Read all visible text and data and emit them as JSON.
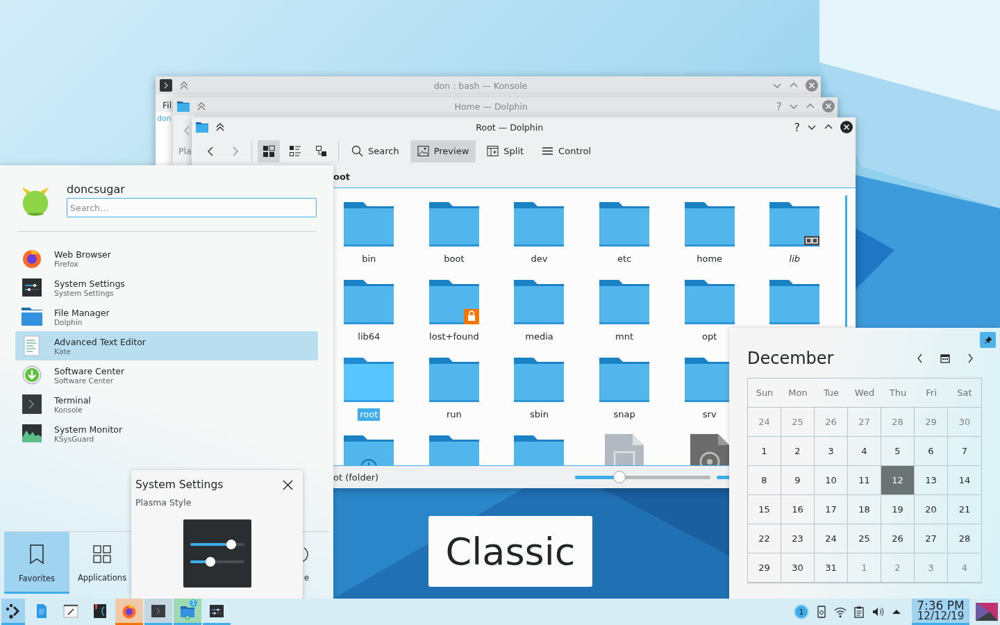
{
  "desktop": {
    "widget_text": "Classic"
  },
  "konsole": {
    "title": "don : bash — Konsole",
    "menu_fragment": "Fil",
    "prompt_fragment": "don"
  },
  "home_dolphin": {
    "title": "Home — Dolphin",
    "help": "?",
    "places_fragment": "Pla"
  },
  "root_dolphin": {
    "title": "Root — Dolphin",
    "help": "?",
    "view_modes": [
      {
        "kind": "icons",
        "selected": true
      },
      {
        "kind": "compact",
        "selected": false
      },
      {
        "kind": "details",
        "selected": false
      }
    ],
    "actions": [
      {
        "label": "Search",
        "kind": "search",
        "selected": false
      },
      {
        "label": "Preview",
        "kind": "preview",
        "selected": true
      },
      {
        "label": "Split",
        "kind": "split",
        "selected": false
      },
      {
        "label": "Control",
        "kind": "menu",
        "selected": false
      }
    ],
    "breadcrumb": "oot",
    "rows": [
      [
        {
          "name": "bin",
          "kind": "folder",
          "selected": false
        },
        {
          "name": "boot",
          "kind": "folder",
          "selected": false
        },
        {
          "name": "dev",
          "kind": "folder",
          "selected": false
        },
        {
          "name": "etc",
          "kind": "folder",
          "selected": false
        },
        {
          "name": "home",
          "kind": "folder",
          "selected": false
        },
        {
          "name": "lib",
          "kind": "folder-link",
          "selected": false
        }
      ],
      [
        {
          "name": "lib64",
          "kind": "folder",
          "selected": false
        },
        {
          "name": "lost+found",
          "kind": "folder-locked",
          "selected": false
        },
        {
          "name": "media",
          "kind": "folder",
          "selected": false
        },
        {
          "name": "mnt",
          "kind": "folder",
          "selected": false
        },
        {
          "name": "opt",
          "kind": "folder",
          "selected": false
        },
        {
          "kind": "folder",
          "selected": false
        }
      ],
      [
        {
          "name": "root",
          "kind": "folder",
          "selected": true
        },
        {
          "name": "run",
          "kind": "folder",
          "selected": false
        },
        {
          "name": "sbin",
          "kind": "folder",
          "selected": false
        },
        {
          "name": "snap",
          "kind": "folder",
          "selected": false
        },
        {
          "name": "srv",
          "kind": "folder",
          "selected": false
        }
      ],
      [
        {
          "kind": "folder-clock",
          "selected": false
        },
        {
          "kind": "folder",
          "selected": false
        },
        {
          "kind": "folder",
          "selected": false
        },
        {
          "kind": "file-unknown",
          "selected": false
        },
        {
          "kind": "file-disc",
          "selected": false
        }
      ]
    ],
    "status": "ot (folder)",
    "zoom": {
      "level": 0.33
    }
  },
  "start_menu": {
    "user": "doncsugar",
    "search": {
      "placeholder": "Search…"
    },
    "apps": [
      {
        "name": "Web Browser",
        "generic": "Firefox",
        "kind": "firefox",
        "selected": false
      },
      {
        "name": "System Settings",
        "generic": "System Settings",
        "kind": "settings",
        "selected": false
      },
      {
        "name": "File Manager",
        "generic": "Dolphin",
        "kind": "file-manager",
        "selected": false
      },
      {
        "name": "Advanced Text Editor",
        "generic": "Kate",
        "kind": "text-editor",
        "selected": true
      },
      {
        "name": "Software Center",
        "generic": "Software Center",
        "kind": "software",
        "selected": false
      },
      {
        "name": "Terminal",
        "generic": "Konsole",
        "kind": "terminal",
        "selected": false
      },
      {
        "name": "System Monitor",
        "generic": "KSysGuard",
        "kind": "monitor",
        "selected": false
      }
    ],
    "tabs": [
      {
        "label": "Favorites",
        "kind": "favorites",
        "selected": true
      },
      {
        "label": "Applications",
        "kind": "applications",
        "selected": false
      },
      {
        "label": "e",
        "kind": "leave",
        "selected": false
      }
    ]
  },
  "tooltip": {
    "title": "System Settings",
    "subtitle": "Plasma Style"
  },
  "calendar": {
    "month": "December",
    "pinned": true,
    "weekdays": [
      "Sun",
      "Mon",
      "Tue",
      "Wed",
      "Thu",
      "Fri",
      "Sat"
    ],
    "days": [
      {
        "label": "24",
        "current_month": false,
        "selected": false
      },
      {
        "label": "25",
        "current_month": false,
        "selected": false
      },
      {
        "label": "26",
        "current_month": false,
        "selected": false
      },
      {
        "label": "27",
        "current_month": false,
        "selected": false
      },
      {
        "label": "28",
        "current_month": false,
        "selected": false
      },
      {
        "label": "29",
        "current_month": false,
        "selected": false
      },
      {
        "label": "30",
        "current_month": false,
        "selected": false
      },
      {
        "label": "1",
        "current_month": true,
        "selected": false
      },
      {
        "label": "2",
        "current_month": true,
        "selected": false
      },
      {
        "label": "3",
        "current_month": true,
        "selected": false
      },
      {
        "label": "4",
        "current_month": true,
        "selected": false
      },
      {
        "label": "5",
        "current_month": true,
        "selected": false
      },
      {
        "label": "6",
        "current_month": true,
        "selected": false
      },
      {
        "label": "7",
        "current_month": true,
        "selected": false
      },
      {
        "label": "8",
        "current_month": true,
        "selected": false
      },
      {
        "label": "9",
        "current_month": true,
        "selected": false
      },
      {
        "label": "10",
        "current_month": true,
        "selected": false
      },
      {
        "label": "11",
        "current_month": true,
        "selected": false
      },
      {
        "label": "12",
        "current_month": true,
        "selected": true
      },
      {
        "label": "13",
        "current_month": true,
        "selected": false
      },
      {
        "label": "14",
        "current_month": true,
        "selected": false
      },
      {
        "label": "15",
        "current_month": true,
        "selected": false
      },
      {
        "label": "16",
        "current_month": true,
        "selected": false
      },
      {
        "label": "17",
        "current_month": true,
        "selected": false
      },
      {
        "label": "18",
        "current_month": true,
        "selected": false
      },
      {
        "label": "19",
        "current_month": true,
        "selected": false
      },
      {
        "label": "20",
        "current_month": true,
        "selected": false
      },
      {
        "label": "21",
        "current_month": true,
        "selected": false
      },
      {
        "label": "22",
        "current_month": true,
        "selected": false
      },
      {
        "label": "23",
        "current_month": true,
        "selected": false
      },
      {
        "label": "24",
        "current_month": true,
        "selected": false
      },
      {
        "label": "25",
        "current_month": true,
        "selected": false
      },
      {
        "label": "26",
        "current_month": true,
        "selected": false
      },
      {
        "label": "27",
        "current_month": true,
        "selected": false
      },
      {
        "label": "28",
        "current_month": true,
        "selected": false
      },
      {
        "label": "29",
        "current_month": true,
        "selected": false
      },
      {
        "label": "30",
        "current_month": true,
        "selected": false
      },
      {
        "label": "31",
        "current_month": true,
        "selected": false
      },
      {
        "label": "1",
        "current_month": false,
        "selected": false
      },
      {
        "label": "2",
        "current_month": false,
        "selected": false
      },
      {
        "label": "3",
        "current_month": false,
        "selected": false
      },
      {
        "label": "4",
        "current_month": false,
        "selected": false
      }
    ]
  },
  "taskbar": {
    "tasks": [
      {
        "kind": "app-menu",
        "selected": true,
        "open": true,
        "hovered": false,
        "attention": false,
        "drop_target": false
      },
      {
        "kind": "document",
        "selected": false,
        "open": false,
        "hovered": false,
        "attention": false,
        "drop_target": false
      },
      {
        "kind": "notes",
        "selected": false,
        "open": false,
        "hovered": false,
        "attention": false,
        "drop_target": false
      },
      {
        "kind": "ide",
        "selected": false,
        "open": false,
        "hovered": false,
        "attention": false,
        "drop_target": false
      },
      {
        "kind": "firefox",
        "selected": false,
        "open": true,
        "hovered": false,
        "attention": true,
        "drop_target": false
      },
      {
        "kind": "terminal",
        "selected": false,
        "open": true,
        "hovered": true,
        "attention": false,
        "drop_target": false
      },
      {
        "kind": "file-manager",
        "selected": false,
        "open": true,
        "hovered": false,
        "attention": false,
        "drop_target": true,
        "badge": "1"
      },
      {
        "kind": "settings",
        "selected": false,
        "open": true,
        "hovered": false,
        "attention": false,
        "drop_target": false
      }
    ],
    "tray": [
      {
        "kind": "notifications",
        "count": "1"
      },
      {
        "kind": "phone"
      },
      {
        "kind": "wifi"
      },
      {
        "kind": "clipboard"
      },
      {
        "kind": "volume"
      },
      {
        "kind": "expand"
      }
    ],
    "clock": {
      "time": "7:36 PM",
      "date": "12/12/19",
      "selected": true
    }
  }
}
